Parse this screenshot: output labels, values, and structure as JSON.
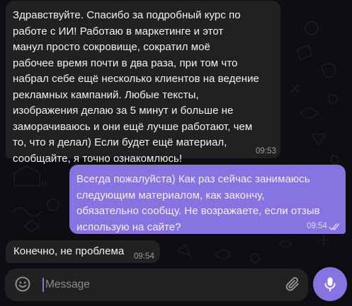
{
  "messages": [
    {
      "direction": "incoming",
      "text": "Здравствуйте. Спасибо за подробный курс по\nработе с ИИ! Работаю в маркетинге и этот\nманул просто сокровище, сократил моё\nрабочее время почти в два раза, при том что\nнабрал себе ещё несколько клиентов на ведение\nрекламных кампаний. Любые тексты,\nизображения делаю за 5 минут и больше не\nзаморачиваюсь и они ещё лучше работают, чем\nто, что я делал) Если будет ещё материал,\nсообщайте, я точно ознакомлюсь!",
      "time": "09:53"
    },
    {
      "direction": "outgoing",
      "text": "Всегда пожалуйста) Как раз сейчас занимаюсь\nследующим материалом, как закончу,\nобязательно сообщу. Не возражаете, если отзыв\nиспользую на сайте?",
      "time": "09:54",
      "status": "read"
    },
    {
      "direction": "incoming",
      "text": "Конечно, не проблема",
      "time": "09:54"
    }
  ],
  "composer": {
    "placeholder": "Message",
    "value": ""
  },
  "icons": {
    "emoji": "smile-icon",
    "attach": "paperclip-icon",
    "send": "microphone-icon",
    "read_status": "double-check-icon"
  },
  "colors": {
    "accent": "#8774e1",
    "incoming_bubble": "#212121",
    "background": "#0e0d12",
    "text": "#f2f2f2"
  }
}
